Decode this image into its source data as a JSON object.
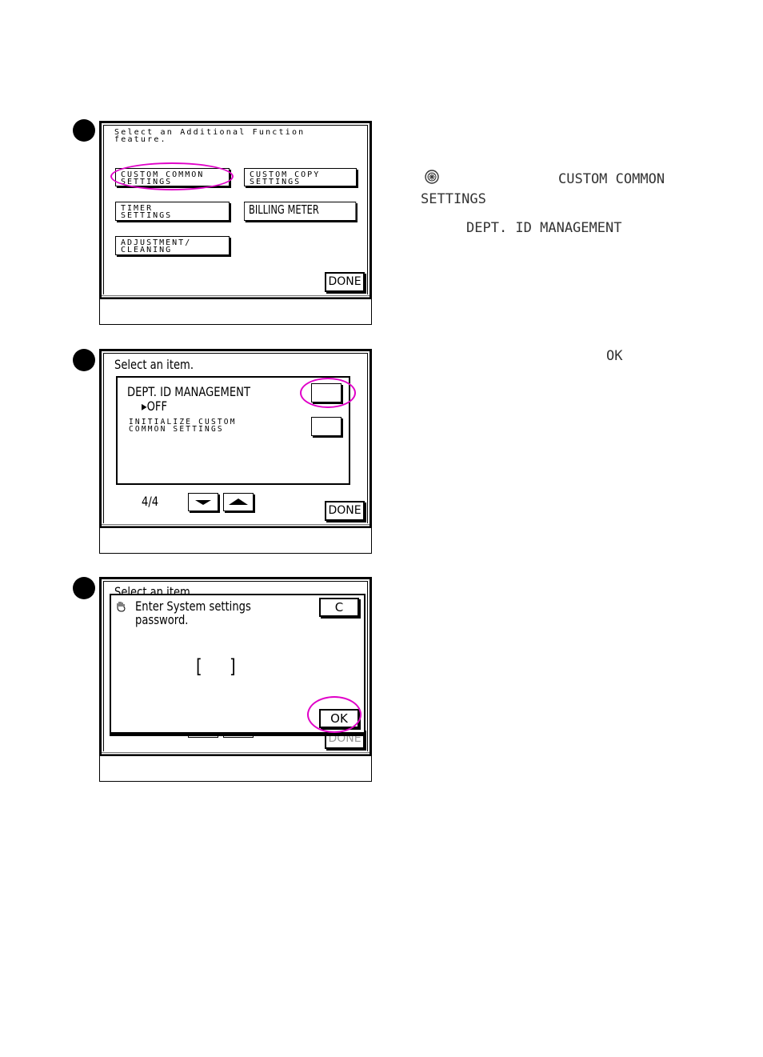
{
  "step1": {
    "prompt": "Select an Additional Function\nfeature.",
    "buttons": {
      "custom_common": "CUSTOM COMMON\nSETTINGS",
      "custom_copy": "CUSTOM COPY\nSETTINGS",
      "timer": "TIMER\nSETTINGS",
      "billing": "BILLING METER",
      "adjustment": "ADJUSTMENT/\nCLEANING"
    },
    "done": "DONE"
  },
  "step2": {
    "prompt": "Select an item.",
    "item1_label": "DEPT. ID MANAGEMENT",
    "item1_value": "▸OFF",
    "item2_label": "INITIALIZE CUSTOM\nCOMMON SETTINGS",
    "page": "4/4",
    "done": "DONE"
  },
  "step3": {
    "behind_prompt": "Select an item.",
    "dialog_line1": "Enter System settings",
    "dialog_line2": "password.",
    "bracket_left": "[",
    "bracket_right": "]",
    "clear": "C",
    "ok": "OK",
    "behind_done": "DONE"
  },
  "instructions": {
    "custom_common": "CUSTOM COMMON",
    "settings": "SETTINGS",
    "dept": "DEPT. ID MANAGEMENT",
    "ok": "OK"
  },
  "colors": {
    "highlight": "#e000c8"
  }
}
